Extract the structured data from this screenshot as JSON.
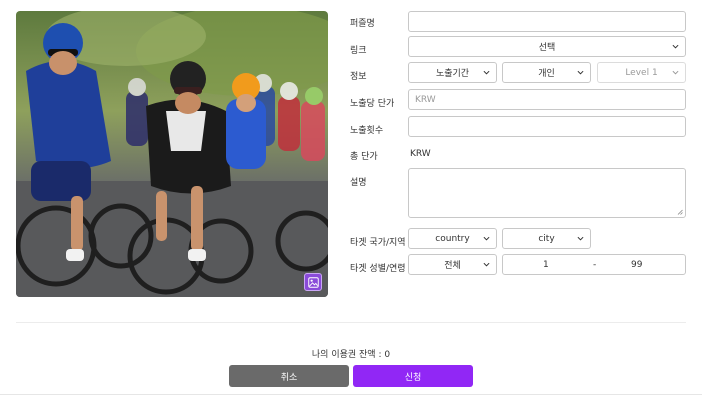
{
  "form": {
    "ad_name": {
      "label": "퍼즐명",
      "value": ""
    },
    "link": {
      "label": "링크",
      "selected": "선택"
    },
    "info": {
      "label": "정보",
      "period": "노출기간",
      "type": "개인",
      "level": "Level 1"
    },
    "unit_price": {
      "label": "노출당 단가",
      "placeholder": "KRW"
    },
    "count": {
      "label": "노출횟수",
      "value": ""
    },
    "total_price": {
      "label": "총 단가",
      "value": "KRW"
    },
    "description": {
      "label": "설명",
      "value": ""
    },
    "target_region": {
      "label": "타겟 국가/지역",
      "country": "country",
      "city": "city"
    },
    "target_gender_age": {
      "label": "타겟 성별/연령",
      "gender": "전체",
      "age_min": "1",
      "age_sep": "-",
      "age_max": "99"
    }
  },
  "footer": {
    "balance": "나의 이용권 잔액 : 0",
    "cancel_label": "취소",
    "apply_label": "신청"
  },
  "icons": {
    "image_upload": "image-icon",
    "dropdown": "chevron-down-icon"
  },
  "colors": {
    "accent": "#9127f5",
    "cancel": "#6a6a6a"
  }
}
